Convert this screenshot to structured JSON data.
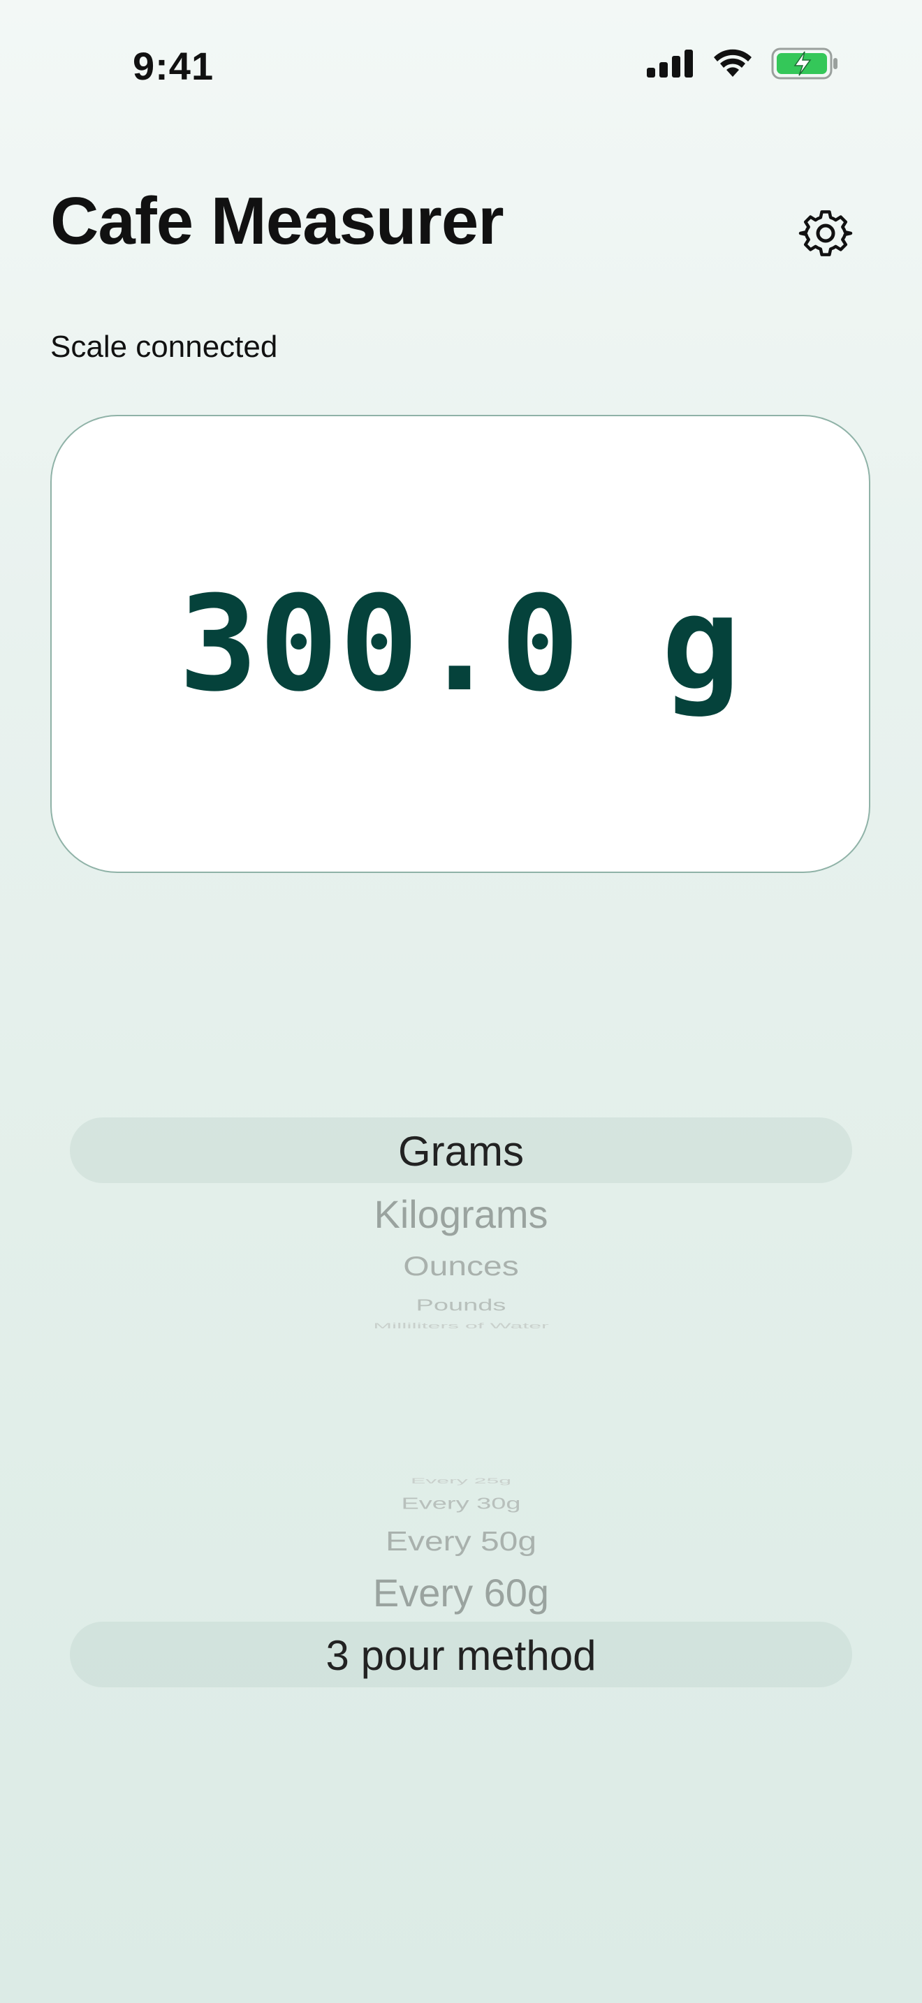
{
  "status_bar": {
    "time": "9:41",
    "icons": [
      "signal-icon",
      "wifi-icon",
      "battery-charging-icon"
    ],
    "battery_color": "#34c759"
  },
  "header": {
    "title": "Cafe Measurer",
    "settings_icon": "gear-icon"
  },
  "scale": {
    "status": "Scale connected",
    "weight": "300.0 g"
  },
  "unit_picker": {
    "selected": "Grams",
    "options": [
      "Grams",
      "Kilograms",
      "Ounces",
      "Pounds",
      "Milliliters of Water"
    ]
  },
  "interval_picker": {
    "selected": "3 pour method",
    "options": [
      "Every 25g",
      "Every 30g",
      "Every 50g",
      "Every 60g",
      "3 pour method"
    ]
  },
  "colors": {
    "accent": "#05423b",
    "card_border": "#8fb2a7",
    "background": "#e3efea"
  }
}
